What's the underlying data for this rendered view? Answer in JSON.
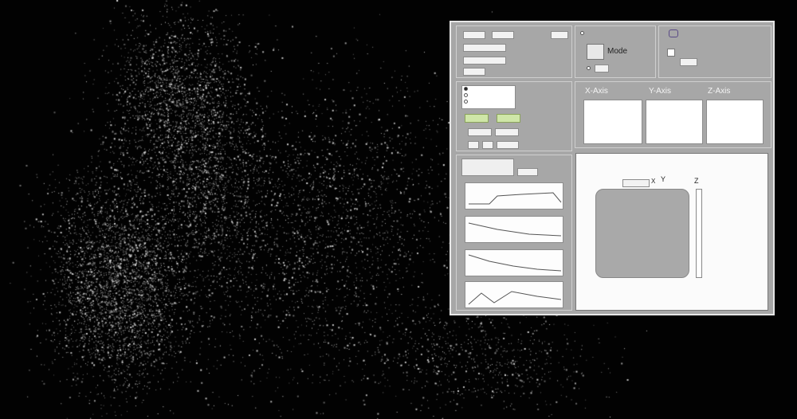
{
  "colors": {
    "background": "#020202",
    "points": "#d8d8d8",
    "panel": "#a7a7a7",
    "viewport_square": "#a9a9a9"
  },
  "view": {
    "label": "Mode",
    "subtitle": "",
    "axes": [
      "X",
      "Y",
      "Z"
    ]
  },
  "controls": {
    "top_fields": [],
    "top_labels": [],
    "checkbox_options": [],
    "mode_button": "Mode",
    "buttons": [],
    "graph_labels": []
  },
  "axis_panels": [
    {
      "title": "X-Axis",
      "options": [],
      "selected": 0
    },
    {
      "title": "Y-Axis",
      "options": [],
      "selected": 1
    },
    {
      "title": "Z-Axis",
      "options": [],
      "selected": 2
    }
  ],
  "view_controls": {
    "step_label": "",
    "step_value": "",
    "axis_x": "X",
    "axis_y": "Y",
    "axis_z": "Z"
  }
}
